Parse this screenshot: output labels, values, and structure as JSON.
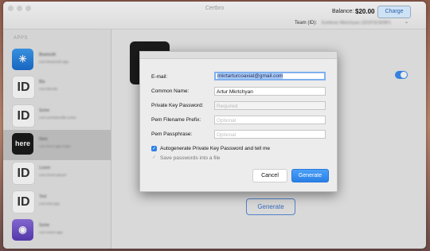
{
  "window": {
    "title": "Certbro"
  },
  "header": {
    "balance_label": "Balance:",
    "balance_value": "$20.00",
    "charge_label": "Charge",
    "team_label": "Team (ID):",
    "team_value": "Evelinne Mkrtchyan (2D2F3C82BF)"
  },
  "sidebar": {
    "heading": "APPS",
    "items": [
      {
        "icon": "bluetooth-app-icon",
        "icon_text": "✳",
        "name": "Bluetooth",
        "sub": "com.bluetooth.app"
      },
      {
        "icon": "id-icon",
        "icon_text": "ID",
        "name": "Bla",
        "sub": "com.bla.bla"
      },
      {
        "icon": "id-icon",
        "icon_text": "ID",
        "name": "Some",
        "sub": "com.somebundle.some"
      },
      {
        "icon": "here-app-icon",
        "icon_text": "here",
        "name": "Here",
        "sub": "com.here.app.maps"
      },
      {
        "icon": "id-icon",
        "icon_text": "ID",
        "name": "Lorem",
        "sub": "com.lorem.ipsum"
      },
      {
        "icon": "id-icon",
        "icon_text": "ID",
        "name": "Test",
        "sub": "com.test.app"
      },
      {
        "icon": "purple-app-icon",
        "icon_text": "◉",
        "name": "Some",
        "sub": "com.some.app"
      }
    ]
  },
  "main": {
    "generate_label": "Generate"
  },
  "dialog": {
    "email_label": "E-mail:",
    "email_value": "mkrtarturcoaxial@gmail.com",
    "common_name_label": "Common Name:",
    "common_name_value": "Artur Mkrtchyan",
    "private_key_label": "Private Key Password:",
    "private_key_placeholder": "Required",
    "pem_prefix_label": "Pem Filename Prefix:",
    "pem_prefix_placeholder": "Optional",
    "pem_pass_label": "Pem Passphrase:",
    "pem_pass_placeholder": "Optional",
    "autogen_label": "Autogenerate Private Key Password and tell me",
    "save_label": "Save passwords into a file",
    "cancel_label": "Cancel",
    "generate_label": "Generate"
  },
  "colors": {
    "accent": "#2a7fe6",
    "traffic_red": "#ff5f57",
    "traffic_yellow": "#ffbd2e",
    "traffic_green": "#28c940"
  }
}
